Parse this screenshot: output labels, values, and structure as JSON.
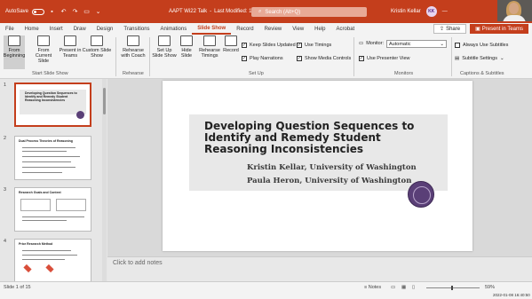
{
  "titlebar": {
    "autosave_label": "AutoSave",
    "autosave_state": "Off",
    "file_title": "AAPT Wi22 Talk",
    "last_modified": "Last Modified: 17h ago",
    "search_placeholder": "Search (Alt+Q)",
    "user_name": "Kristin Kellar",
    "user_initials": "KK"
  },
  "ribbon": {
    "tabs": [
      "File",
      "Home",
      "Insert",
      "Draw",
      "Design",
      "Transitions",
      "Animations",
      "Slide Show",
      "Record",
      "Review",
      "View",
      "Help",
      "Acrobat"
    ],
    "active_tab": "Slide Show",
    "share_label": "Share",
    "teams_label": "Present in Teams",
    "buttons": {
      "from_beginning": "From Beginning",
      "from_current": "From Current Slide",
      "present_teams": "Present in Teams",
      "custom_show": "Custom Slide Show",
      "rehearse_coach": "Rehearse with Coach",
      "setup_show": "Set Up Slide Show",
      "hide_slide": "Hide Slide",
      "rehearse_timings": "Rehearse Timings",
      "record": "Record"
    },
    "checks": {
      "keep_updated": "Keep Slides Updated",
      "use_timings": "Use Timings",
      "play_narrations": "Play Narrations",
      "show_media": "Show Media Controls",
      "presenter_view": "Use Presenter View",
      "always_subtitles": "Always Use Subtitles",
      "subtitle_settings": "Subtitle Settings"
    },
    "monitor_label": "Monitor:",
    "monitor_value": "Automatic",
    "groups": {
      "start": "Start Slide Show",
      "rehearse": "Rehearse",
      "setup": "Set Up",
      "monitors": "Monitors",
      "captions": "Captions & Subtitles"
    }
  },
  "thumbnails": [
    {
      "num": "1",
      "title": "Developing Question Sequences to Identify and Remedy Student Reasoning Inconsistencies"
    },
    {
      "num": "2",
      "title": "Dual Process Theories of Reasoning"
    },
    {
      "num": "3",
      "title": "Research Goals and Context"
    },
    {
      "num": "4",
      "title": "Prior Research Method"
    }
  ],
  "slide": {
    "title": "Developing Question Sequences to Identify and Remedy Student Reasoning Inconsistencies",
    "author1": "Kristin Kellar, University of Washington",
    "author2": "Paula Heron, University of Washington"
  },
  "notes_placeholder": "Click to add notes",
  "status": {
    "slide_info": "Slide 1 of 15",
    "notes_label": "Notes",
    "zoom": "59%",
    "clock": "2022-01-08 16:40:50"
  },
  "colors": {
    "accent": "#c43e1c",
    "uw_purple": "#5a3f77"
  }
}
